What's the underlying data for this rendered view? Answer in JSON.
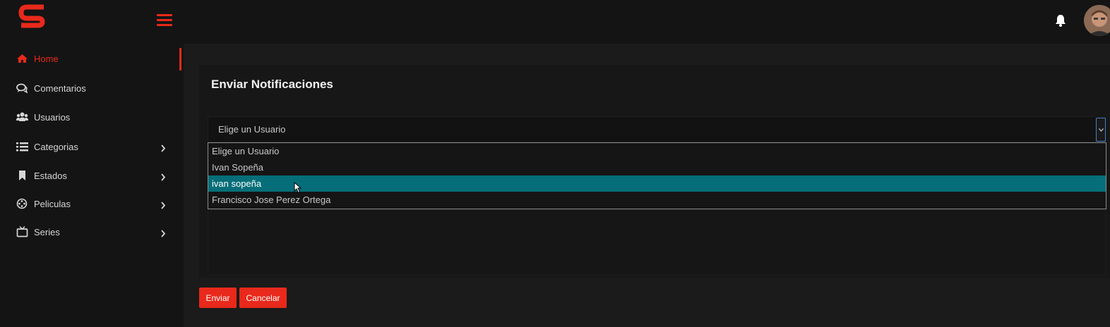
{
  "header": {
    "logo_icon": "s-logo-icon",
    "menu_icon": "hamburger-icon",
    "notification_icon": "bell-icon",
    "avatar_icon": "user-avatar",
    "accent_color": "#e8291b"
  },
  "sidebar": {
    "items": [
      {
        "label": "Home",
        "icon": "home-icon",
        "active": true,
        "has_submenu": false
      },
      {
        "label": "Comentarios",
        "icon": "comments-icon",
        "active": false,
        "has_submenu": false
      },
      {
        "label": "Usuarios",
        "icon": "users-icon",
        "active": false,
        "has_submenu": false
      },
      {
        "label": "Categorias",
        "icon": "list-icon",
        "active": false,
        "has_submenu": true
      },
      {
        "label": "Estados",
        "icon": "bookmark-icon",
        "active": false,
        "has_submenu": true
      },
      {
        "label": "Peliculas",
        "icon": "film-reel-icon",
        "active": false,
        "has_submenu": true
      },
      {
        "label": "Series",
        "icon": "tv-icon",
        "active": false,
        "has_submenu": true
      }
    ]
  },
  "main": {
    "title": "Enviar Notificaciones",
    "user_select": {
      "selected_label": "Elige un Usuario",
      "options": [
        {
          "label": "Elige un Usuario",
          "highlighted": false
        },
        {
          "label": "Ivan Sopeña",
          "highlighted": false
        },
        {
          "label": "ivan sopeña",
          "highlighted": true
        },
        {
          "label": "Francisco Jose Perez Ortega",
          "highlighted": false
        }
      ],
      "highlight_color": "#056e78"
    },
    "buttons": {
      "send_label": "Enviar",
      "cancel_label": "Cancelar"
    }
  }
}
